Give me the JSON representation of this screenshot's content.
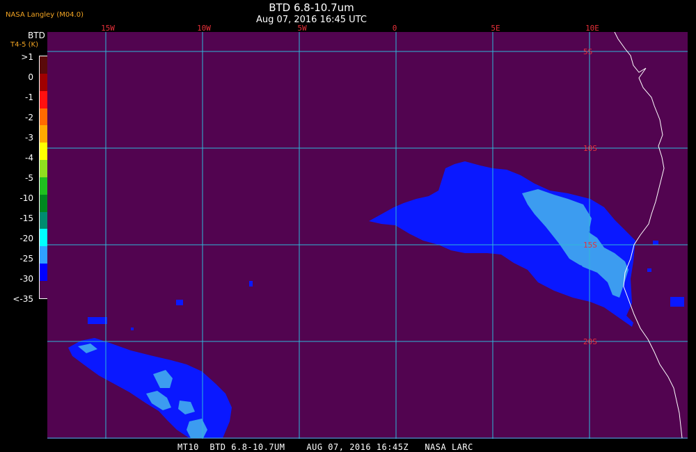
{
  "header": {
    "org": "NASA Langley (M04.0)",
    "title": "BTD 6.8-10.7um",
    "subtitle": "Aug 07, 2016 16:45 UTC"
  },
  "colorbar": {
    "label": "BTD",
    "units": "T4-5 (K)",
    "ticks": [
      ">1",
      "0",
      "-1",
      "-2",
      "-3",
      "-4",
      "-5",
      "-10",
      "-15",
      "-20",
      "-25",
      "-30",
      "<-35"
    ],
    "colors": [
      "#5a0a0a",
      "#a00000",
      "#ff1010",
      "#ff6a00",
      "#ffaa00",
      "#ffff00",
      "#90e020",
      "#20c020",
      "#008820",
      "#008c70",
      "#00ffff",
      "#30a0ff",
      "#0000ff",
      "#520450"
    ]
  },
  "map": {
    "background": "#520450",
    "grid_color": "#2fb8d8",
    "label_color": "#e8303a",
    "lon_labels": [
      "15W",
      "10W",
      "5W",
      "0",
      "5E",
      "10E"
    ],
    "lat_labels": [
      "5S",
      "10S",
      "15S",
      "20S"
    ]
  },
  "footer": {
    "text": "MT10  BTD 6.8-10.7UM    AUG 07, 2016 16:45Z   NASA LARC"
  }
}
